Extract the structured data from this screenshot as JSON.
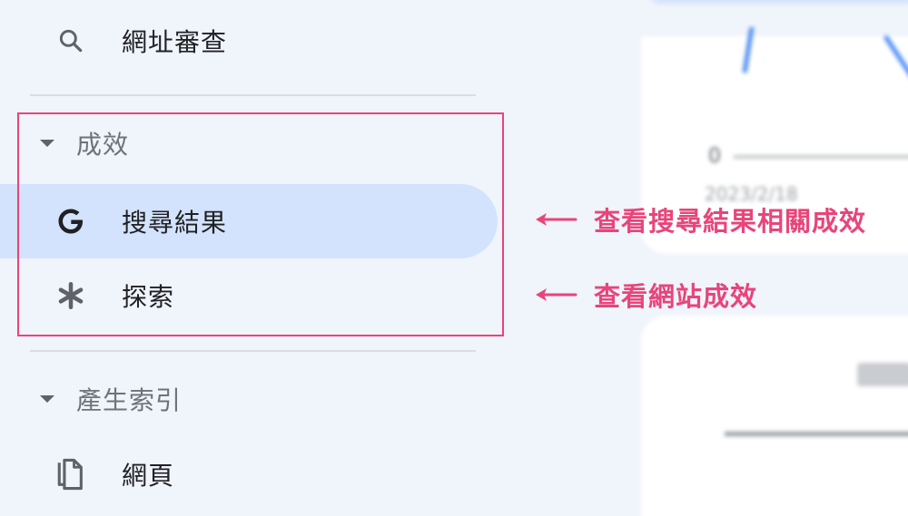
{
  "sidebar": {
    "url_inspection": {
      "label": "網址審查",
      "icon": "search-icon"
    },
    "performance_section": {
      "label": "成效"
    },
    "search_results": {
      "label": "搜尋結果",
      "icon": "google-g-icon"
    },
    "discover": {
      "label": "探索",
      "icon": "asterisk-icon"
    },
    "indexing_section": {
      "label": "產生索引"
    },
    "pages": {
      "label": "網頁",
      "icon": "pages-icon"
    }
  },
  "annotations": {
    "search_results_note": "查看搜尋結果相關成效",
    "discover_note": "查看網站成效"
  },
  "background": {
    "chart_tick_zero": "0",
    "chart_date": "2023/2/18"
  },
  "colors": {
    "accent": "#e8457a",
    "active_row": "#d3e3fd",
    "page_bg": "#f0f4fb"
  }
}
